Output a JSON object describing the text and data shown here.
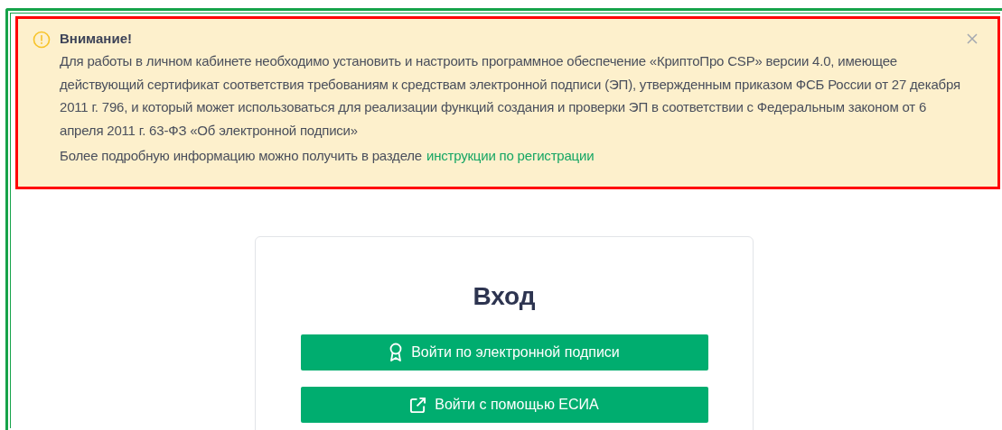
{
  "alert": {
    "title": "Внимание!",
    "message": "Для работы в личном кабинете необходимо установить и настроить программное обеспечение «КриптоПро CSP» версии 4.0, имеющее действующий сертификат соответствия требованиям к средствам электронной подписи (ЭП), утвержденным приказом ФСБ России от 27 декабря 2011 г. 796, и который может использоваться для реализации функций создания и проверки ЭП в соответствии с Федеральным законом от 6 апреля 2011 г. 63-ФЗ «Об электронной подписи»",
    "more_text": "Более подробную информацию можно получить в разделе",
    "more_link": "инструкции по регистрации"
  },
  "login": {
    "title": "Вход",
    "buttons": [
      {
        "kind": "signature",
        "label": "Войти по электронной подписи"
      },
      {
        "kind": "esia",
        "label": "Войти с помощью ЕСИА"
      }
    ]
  }
}
